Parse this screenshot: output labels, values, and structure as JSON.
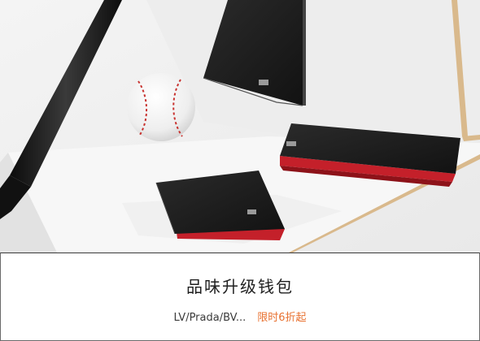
{
  "banner": {
    "title": "品味升级钱包",
    "brands": "LV/Prada/BV...",
    "promo": "限时6折起",
    "colors": {
      "promo": "#e8702f",
      "title": "#1f1f1f",
      "wallet_interior": "#c4202a"
    }
  },
  "hero_image": {
    "icon": "product-photo-wallets"
  }
}
